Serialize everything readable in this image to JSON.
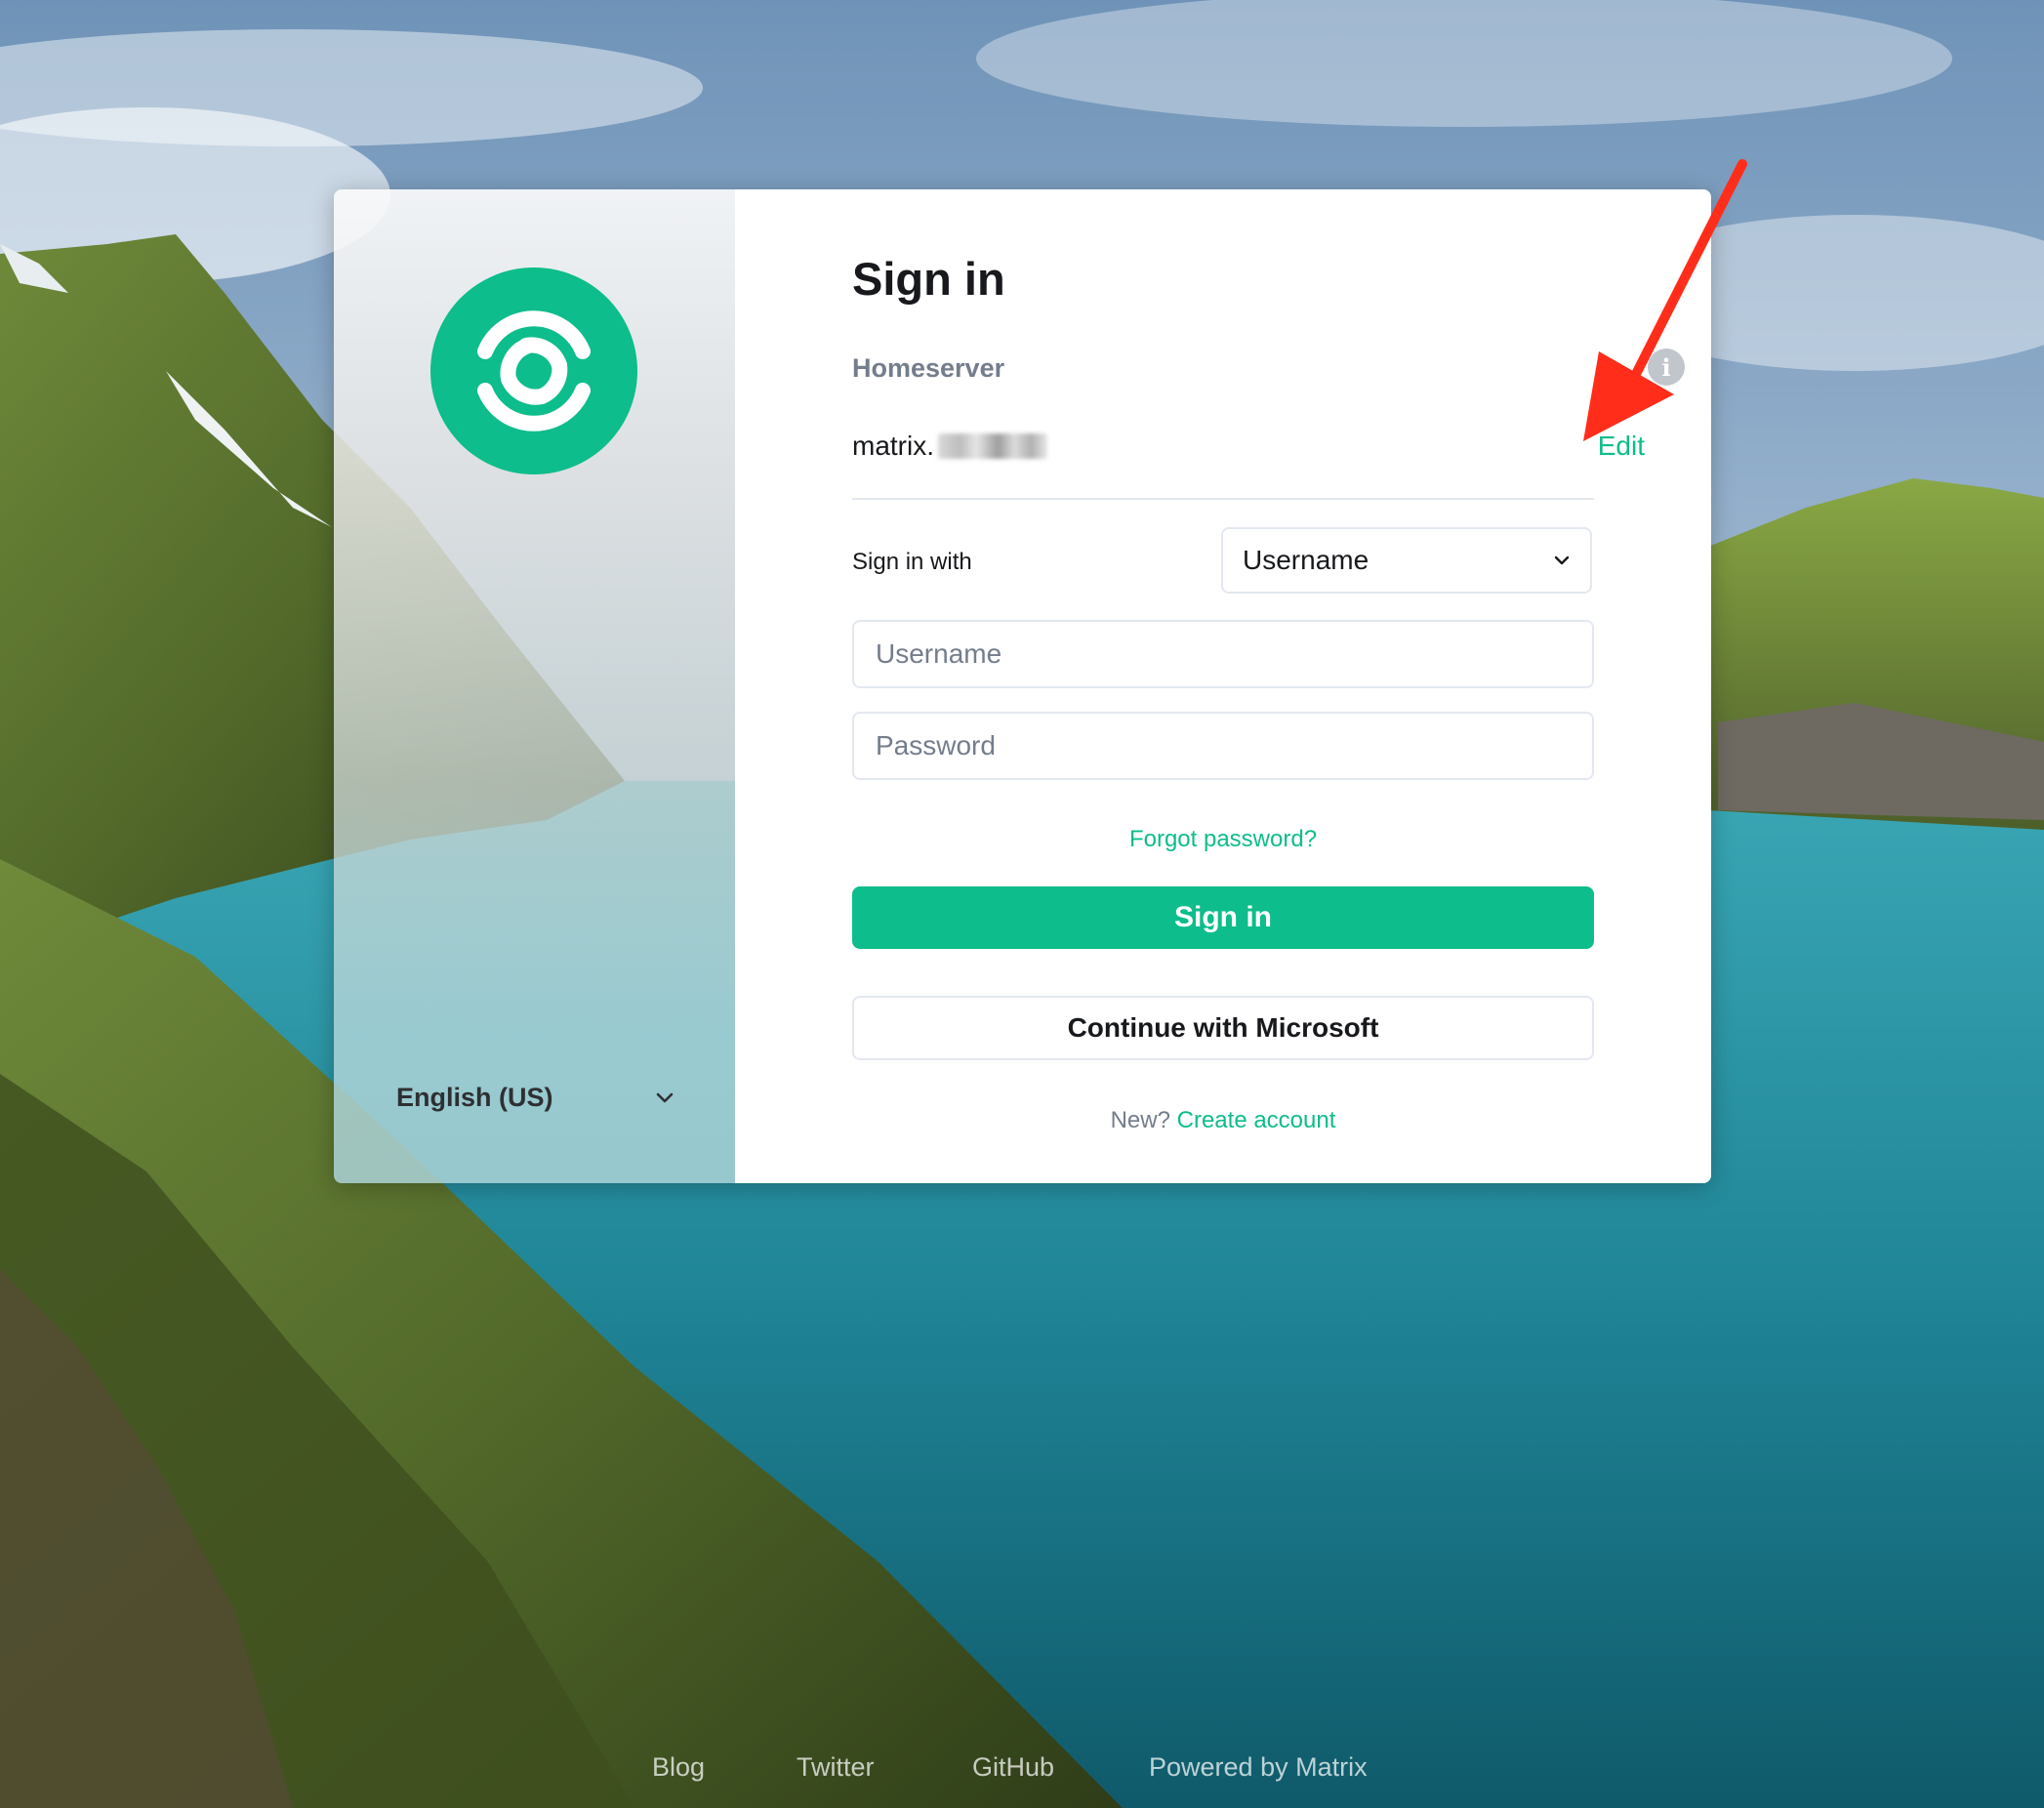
{
  "card": {
    "title": "Sign in",
    "homeserver_label": "Homeserver",
    "info_icon": "info-icon",
    "homeserver_value": "matrix.",
    "edit_label": "Edit",
    "signin_with_label": "Sign in with",
    "signin_with_selected": "Username",
    "username_placeholder": "Username",
    "password_placeholder": "Password",
    "forgot_password": "Forgot password?",
    "signin_button": "Sign in",
    "microsoft_button": "Continue with Microsoft",
    "new_prefix": "New?",
    "create_account": "Create account"
  },
  "sidebar": {
    "language": "English (US)"
  },
  "footer": {
    "links": [
      "Blog",
      "Twitter",
      "GitHub",
      "Powered by Matrix"
    ]
  },
  "colors": {
    "accent": "#0dbd8b",
    "annotation_arrow": "#ff2d1a"
  }
}
